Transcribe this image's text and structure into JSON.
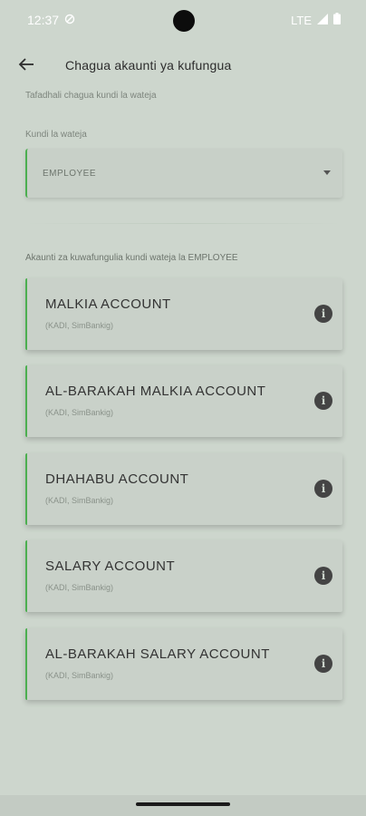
{
  "status": {
    "time": "12:37",
    "network": "LTE"
  },
  "header": {
    "title": "Chagua akaunti ya kufungua"
  },
  "instruction": "Tafadhali chagua kundi la wateja",
  "customer_group": {
    "label": "Kundi la wateja",
    "value": "EMPLOYEE"
  },
  "accounts_heading": "Akaunti za kuwafungulia kundi wateja la  EMPLOYEE",
  "accounts": [
    {
      "name": "MALKIA ACCOUNT",
      "channels": "(KADI, SimBankig)"
    },
    {
      "name": "AL-BARAKAH MALKIA ACCOUNT",
      "channels": "(KADI, SimBankig)"
    },
    {
      "name": "DHAHABU ACCOUNT",
      "channels": "(KADI, SimBankig)"
    },
    {
      "name": "SALARY ACCOUNT",
      "channels": "(KADI, SimBankig)"
    },
    {
      "name": "AL-BARAKAH SALARY ACCOUNT",
      "channels": "(KADI, SimBankig)"
    }
  ],
  "colors": {
    "accent": "#4caf50",
    "background": "#cdd6cd"
  }
}
